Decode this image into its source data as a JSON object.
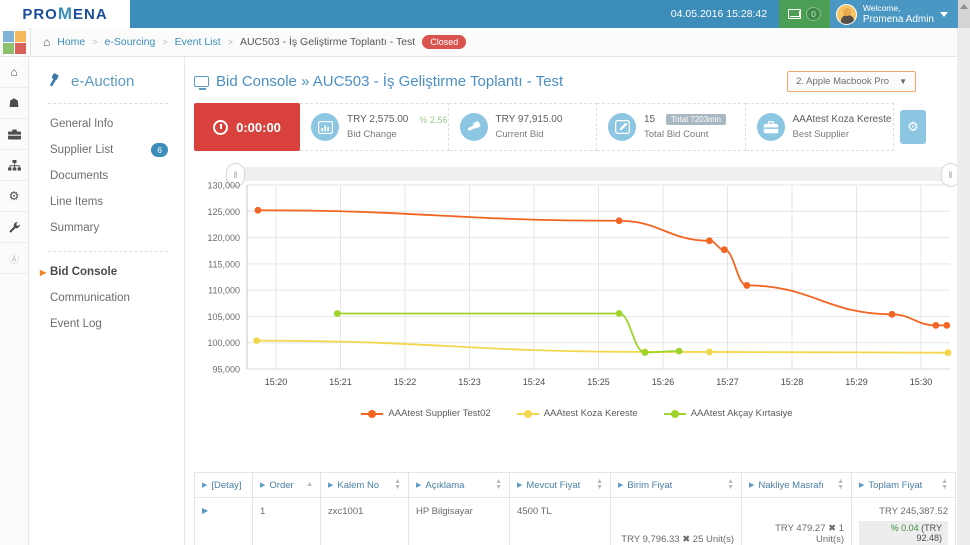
{
  "topbar": {
    "brand_pro": "PRO",
    "brand_m": "M",
    "brand_ena": "ENA",
    "datetime": "04.05.2016 15:28:42",
    "mail_count": "0",
    "welcome_label": "Welcome,",
    "user_name": "Promena Admin"
  },
  "breadcrumb": {
    "home": "Home",
    "level2": "e-Sourcing",
    "level3": "Event List",
    "current": "AUC503 - İş Geliştirme Toplantı - Test",
    "status": "Closed",
    "separator": ">"
  },
  "rail": {
    "items": [
      {
        "icon": "home-icon",
        "glyph": "⌂"
      },
      {
        "icon": "box-icon",
        "glyph": "❑"
      },
      {
        "icon": "briefcase-icon",
        "glyph": "ὋC"
      },
      {
        "icon": "sitemap-icon",
        "glyph": "⑂"
      },
      {
        "icon": "gear-icon",
        "glyph": "⚙"
      },
      {
        "icon": "wrench-icon",
        "glyph": "ὒ7"
      },
      {
        "icon": "collapse-icon",
        "glyph": "«"
      }
    ]
  },
  "sidebar": {
    "title": "e-Auction",
    "title_icon": "gavel-icon",
    "group1": [
      {
        "label": "General Info",
        "badge": ""
      },
      {
        "label": "Supplier List",
        "badge": "6"
      },
      {
        "label": "Documents",
        "badge": ""
      },
      {
        "label": "Line Items",
        "badge": ""
      },
      {
        "label": "Summary",
        "badge": ""
      }
    ],
    "group2": [
      {
        "label": "Bid Console",
        "active": true
      },
      {
        "label": "Communication",
        "active": false
      },
      {
        "label": "Event Log",
        "active": false
      }
    ]
  },
  "page": {
    "title_prefix": "Bid Console",
    "title_sep": "»",
    "title_main": "AUC503 - İş Geliştirme Toplantı - Test",
    "item_select": "2. Apple Macbook Pro",
    "settings_button": "settings"
  },
  "stats": {
    "timer": "0:00:00",
    "cards": [
      {
        "icon": "bar-chart-icon",
        "value": "TRY 2,575.00",
        "extra": "% 2.56",
        "extra_kind": "pct",
        "label": "Bid Change"
      },
      {
        "icon": "gavel-icon",
        "value": "TRY 97,915.00",
        "extra": "",
        "extra_kind": "",
        "label": "Current Bid"
      },
      {
        "icon": "edit-icon",
        "value": "15",
        "extra": "Total 7203min",
        "extra_kind": "chip",
        "label": "Total Bid Count"
      },
      {
        "icon": "briefcase-icon",
        "value": "AAAtest Koza Kereste",
        "extra": "",
        "extra_kind": "",
        "label": "Best Supplier"
      }
    ]
  },
  "chart_data": {
    "type": "line",
    "title": "",
    "xlabel": "",
    "ylabel": "",
    "ylim": [
      95000,
      130000
    ],
    "yticks": [
      "95,000",
      "100,000",
      "105,000",
      "110,000",
      "115,000",
      "120,000",
      "125,000",
      "130,000"
    ],
    "ytick_values": [
      95000,
      100000,
      105000,
      110000,
      115000,
      120000,
      125000,
      130000
    ],
    "xticks": [
      "15:20",
      "15:21",
      "15:22",
      "15:23",
      "15:24",
      "15:25",
      "15:26",
      "15:27",
      "15:28",
      "15:29",
      "15:30"
    ],
    "xlim_minutes": [
      19.55,
      30.45
    ],
    "grid": true,
    "legend_position": "bottom",
    "series": [
      {
        "name": "AAAtest Supplier Test02",
        "color": "#f26522",
        "points": [
          {
            "t": 19.72,
            "y": 125200
          },
          {
            "t": 25.32,
            "y": 123200
          },
          {
            "t": 26.72,
            "y": 119400
          },
          {
            "t": 26.95,
            "y": 117700
          },
          {
            "t": 27.3,
            "y": 110900
          },
          {
            "t": 29.55,
            "y": 105400
          },
          {
            "t": 30.23,
            "y": 103300
          },
          {
            "t": 30.4,
            "y": 103300
          }
        ]
      },
      {
        "name": "AAAtest Koza Kereste",
        "color": "#f2d74e",
        "points": [
          {
            "t": 19.7,
            "y": 100400
          },
          {
            "t": 25.72,
            "y": 98250
          },
          {
            "t": 26.72,
            "y": 98250
          },
          {
            "t": 30.42,
            "y": 98100
          }
        ]
      },
      {
        "name": "AAAtest Akçay Kırtasiye",
        "color": "#9fd52a",
        "points": [
          {
            "t": 20.95,
            "y": 105550
          },
          {
            "t": 25.32,
            "y": 105550
          },
          {
            "t": 25.72,
            "y": 98150
          },
          {
            "t": 26.25,
            "y": 98400
          }
        ]
      }
    ]
  },
  "table": {
    "columns": [
      {
        "label": "[Detay]",
        "sort": "none"
      },
      {
        "label": "Order",
        "sort": "asc"
      },
      {
        "label": "Kalem No",
        "sort": "both"
      },
      {
        "label": "Açıklama",
        "sort": "both"
      },
      {
        "label": "Mevcut Fiyat",
        "sort": "both"
      },
      {
        "label": "Birim Fiyat",
        "sort": "both"
      },
      {
        "label": "Nakliye Masrafı",
        "sort": "both"
      },
      {
        "label": "Toplam Fiyat",
        "sort": "both"
      }
    ],
    "rows": [
      {
        "detail": "▶",
        "order": "1",
        "kalem_no": "zxc1001",
        "aciklama": "HP Bilgisayar",
        "mevcut_fiyat": "4500 TL",
        "birim_fiyat": "TRY 9,796.33 ✖ 25 Unit(s)",
        "nakliye_masrafi": "TRY 479.27 ✖ 1 Unit(s)",
        "toplam_fiyat": "TRY 245,387.52",
        "toplam_pct_sym": "%",
        "toplam_pct": "0.04",
        "toplam_pct_abs": "(TRY 92.48)"
      }
    ]
  },
  "colors": {
    "brand_blue": "#3d8dba",
    "accent_orange": "#f0852c",
    "danger_red": "#d9413c",
    "success_green": "#4c9e54",
    "series_orange": "#f26522",
    "series_yellow": "#f2d74e",
    "series_green": "#9fd52a"
  }
}
